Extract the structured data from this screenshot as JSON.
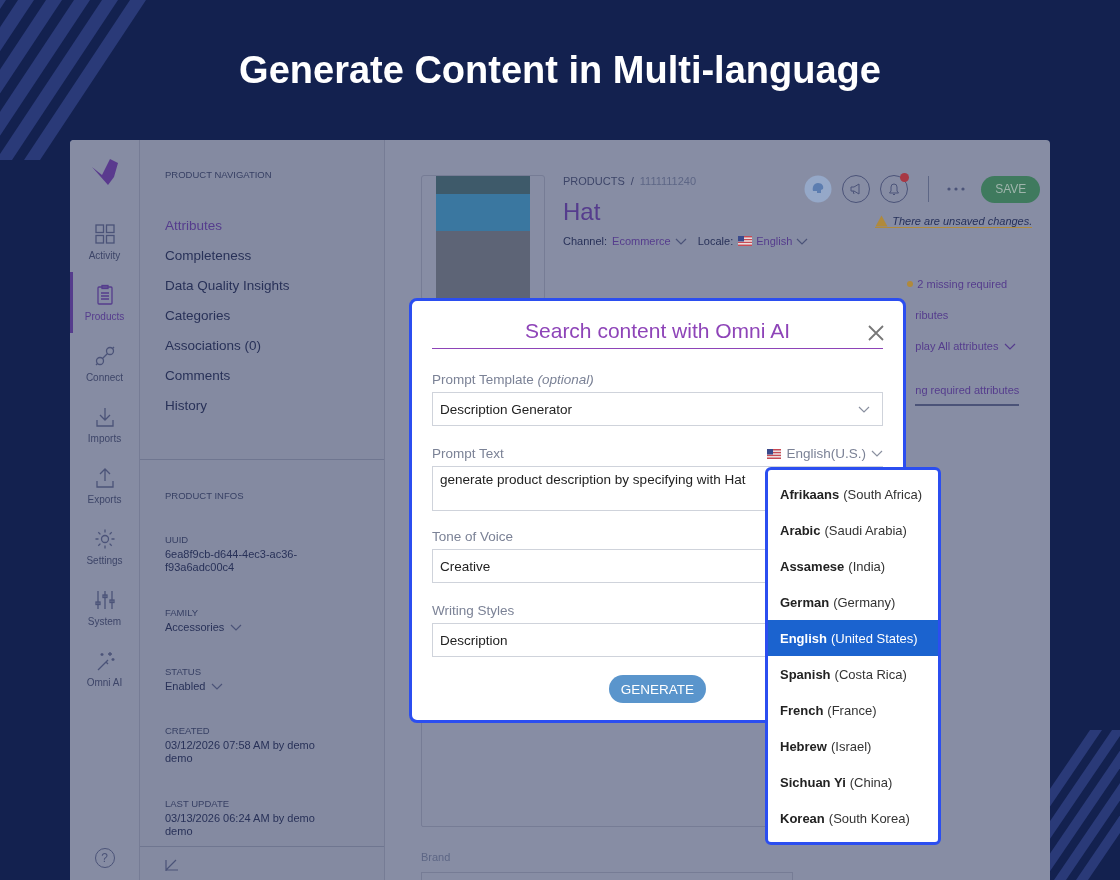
{
  "headline": "Generate Content in Multi-language",
  "rail": {
    "items": [
      {
        "label": "Activity",
        "kind": "grid",
        "selected": false
      },
      {
        "label": "Products",
        "kind": "clipboard",
        "selected": true
      },
      {
        "label": "Connect",
        "kind": "plug",
        "selected": false
      },
      {
        "label": "Imports",
        "kind": "download",
        "selected": false
      },
      {
        "label": "Exports",
        "kind": "upload",
        "selected": false
      },
      {
        "label": "Settings",
        "kind": "gear",
        "selected": false
      },
      {
        "label": "System",
        "kind": "sliders",
        "selected": false
      },
      {
        "label": "Omni AI",
        "kind": "wand",
        "selected": false
      }
    ],
    "help": "?"
  },
  "navigation": {
    "heading": "PRODUCT NAVIGATION",
    "items": [
      {
        "label": "Attributes",
        "selected": true
      },
      {
        "label": "Completeness",
        "selected": false
      },
      {
        "label": "Data Quality Insights",
        "selected": false
      },
      {
        "label": "Categories",
        "selected": false
      },
      {
        "label": "Associations (0)",
        "selected": false
      },
      {
        "label": "Comments",
        "selected": false
      },
      {
        "label": "History",
        "selected": false
      }
    ]
  },
  "product_infos": {
    "heading": "PRODUCT INFOS",
    "fields": [
      {
        "label": "UUID",
        "value": "6ea8f9cb-d644-4ec3-ac36-f93a6adc00c4",
        "dropdown": false
      },
      {
        "label": "FAMILY",
        "value": "Accessories",
        "dropdown": true
      },
      {
        "label": "STATUS",
        "value": "Enabled",
        "dropdown": true
      },
      {
        "label": "CREATED",
        "value": "03/12/2026 07:58 AM by demo demo",
        "dropdown": false
      },
      {
        "label": "LAST UPDATE",
        "value": "03/13/2026 06:24 AM by demo demo",
        "dropdown": false
      }
    ]
  },
  "product": {
    "section": "PRODUCTS",
    "separator": "/",
    "id": "1111111240",
    "name": "Hat",
    "channel_label": "Channel:",
    "channel": "Ecommerce",
    "locale_label": "Locale:",
    "locale": "English"
  },
  "toolbar": {
    "notification_unread": true,
    "save": "SAVE",
    "warning": "There are unsaved changes."
  },
  "completeness": {
    "missing": "2 missing required",
    "lines": [
      {
        "text": "ributes",
        "kind": "link"
      },
      {
        "text": "play All attributes",
        "kind": "dropdown"
      },
      {
        "text": "ng required attributes",
        "kind": "tab"
      }
    ]
  },
  "brand": {
    "label": "Brand"
  },
  "modal": {
    "title": "Search content with Omni AI",
    "language": "English(U.S.)",
    "generate": "GENERATE",
    "fields": [
      {
        "label": "Prompt Template *(optional)*",
        "kind": "select",
        "value": "Description Generator"
      },
      {
        "label": "Prompt Text",
        "kind": "textarea",
        "value": "generate product description by specifying with Hat"
      },
      {
        "label": "Tone of Voice",
        "kind": "select",
        "value": "Creative"
      },
      {
        "label": "Writing Styles",
        "kind": "select",
        "value": "Description"
      }
    ]
  },
  "languages": [
    {
      "name": "Afrikaans",
      "region": "(South Africa)",
      "selected": false
    },
    {
      "name": "Arabic",
      "region": "(Saudi Arabia)",
      "selected": false
    },
    {
      "name": "Assamese",
      "region": "(India)",
      "selected": false
    },
    {
      "name": "German",
      "region": "(Germany)",
      "selected": false
    },
    {
      "name": "English",
      "region": "(United States)",
      "selected": true
    },
    {
      "name": "Spanish",
      "region": "(Costa Rica)",
      "selected": false
    },
    {
      "name": "French",
      "region": "(France)",
      "selected": false
    },
    {
      "name": "Hebrew",
      "region": "(Israel)",
      "selected": false
    },
    {
      "name": "Sichuan Yi",
      "region": "(China)",
      "selected": false
    },
    {
      "name": "Korean",
      "region": "(South Korea)",
      "selected": false
    }
  ]
}
